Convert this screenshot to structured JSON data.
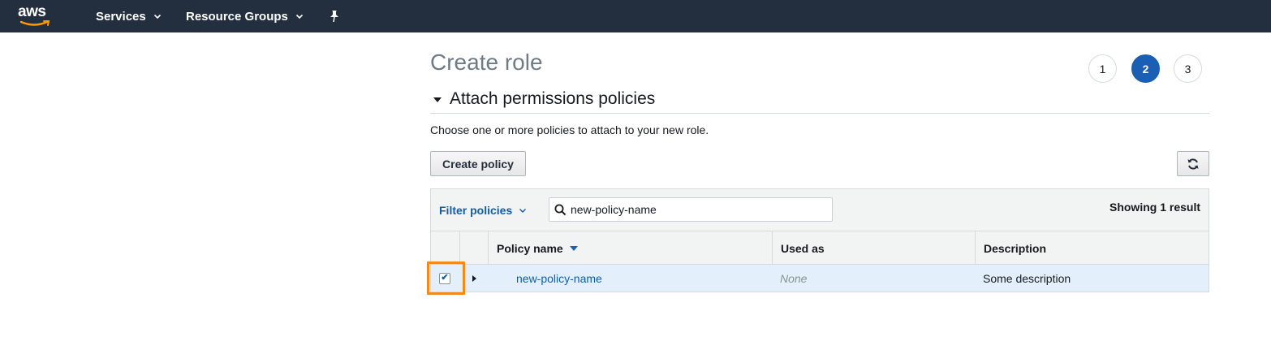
{
  "nav": {
    "logo_text": "aws",
    "services_label": "Services",
    "resource_groups_label": "Resource Groups",
    "pin_icon": "pin-icon"
  },
  "page": {
    "title": "Create role",
    "steps": [
      "1",
      "2",
      "3"
    ],
    "active_step": "2"
  },
  "section": {
    "title": "Attach permissions policies",
    "description": "Choose one or more policies to attach to your new role."
  },
  "toolbar": {
    "create_policy_label": "Create policy",
    "refresh_icon": "refresh-icon"
  },
  "filter": {
    "label": "Filter policies",
    "search_value": "new-policy-name",
    "showing_text": "Showing 1 result"
  },
  "table": {
    "columns": [
      "Policy name",
      "Used as",
      "Description"
    ],
    "rows": [
      {
        "checked": true,
        "policy_name": "new-policy-name",
        "used_as": "None",
        "description": "Some description"
      }
    ]
  },
  "colors": {
    "nav_bg": "#232f3e",
    "accent": "#1a5fb4",
    "link": "#0f5ea8",
    "highlight": "#f38a1b",
    "selected_row": "#e3f0fc"
  }
}
